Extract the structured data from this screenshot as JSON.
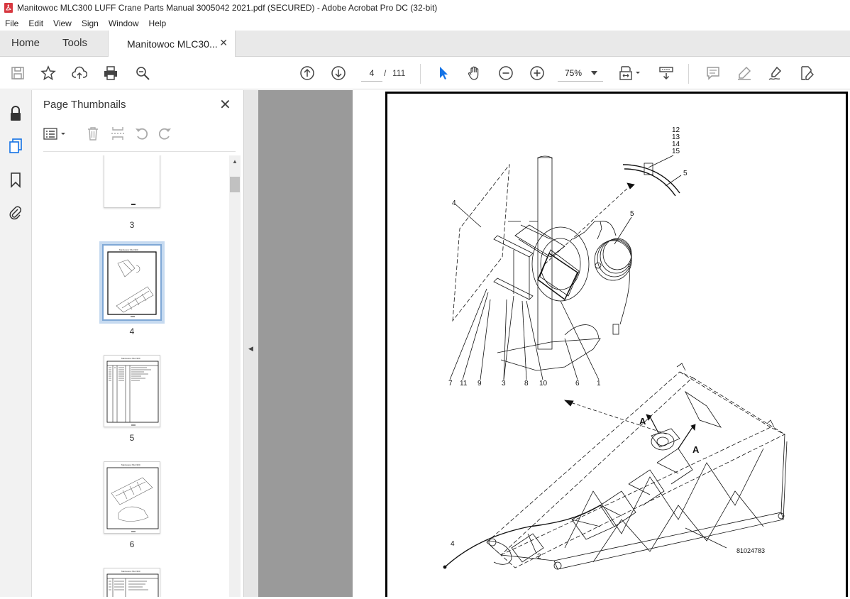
{
  "window": {
    "title": "Manitowoc MLC300 LUFF Crane Parts Manual 3005042 2021.pdf (SECURED) - Adobe Acrobat Pro DC (32-bit)"
  },
  "menu": [
    "File",
    "Edit",
    "View",
    "Sign",
    "Window",
    "Help"
  ],
  "tabs": {
    "home": "Home",
    "tools": "Tools",
    "document": "Manitowoc MLC30..."
  },
  "toolbar": {
    "current_page": "4",
    "page_separator": "/",
    "total_pages": "111",
    "zoom": "75%"
  },
  "thumbnail_panel": {
    "title": "Page Thumbnails",
    "thumbnails": [
      {
        "label": "3"
      },
      {
        "label": "4",
        "selected": true
      },
      {
        "label": "5"
      },
      {
        "label": "6"
      }
    ]
  },
  "diagram": {
    "callouts_top": [
      "12",
      "13",
      "14",
      "15",
      "5",
      "4",
      "5"
    ],
    "callouts_bottom_row": [
      "7",
      "11",
      "9",
      "3",
      "8",
      "10",
      "6",
      "1"
    ],
    "section_markers": [
      "A",
      "A"
    ],
    "callouts_lower": [
      "4",
      "2"
    ],
    "drawing_number": "81024783"
  },
  "colors": {
    "accent": "#1473e6",
    "pdf_red": "#d7373f",
    "workspace": "#9a9a9a",
    "selection": "#c6daf0"
  }
}
